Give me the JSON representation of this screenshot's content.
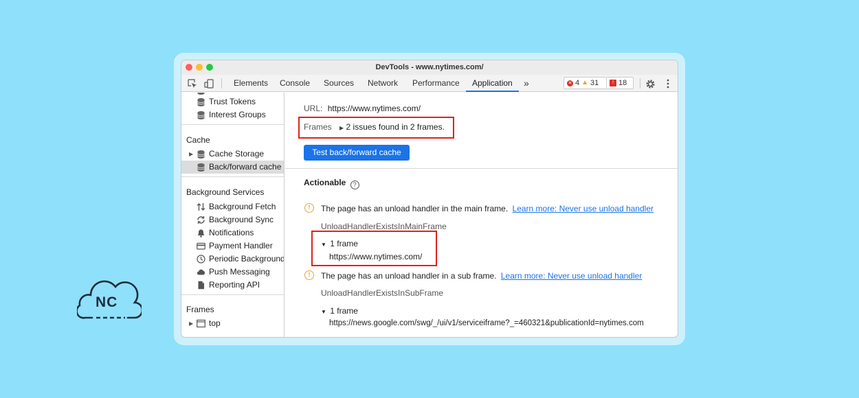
{
  "window": {
    "title": "DevTools - www.nytimes.com/"
  },
  "toolbar": {
    "icons": [
      "inspect-element-icon",
      "device-toolbar-icon",
      "more-tabs-icon",
      "settings-icon",
      "kebab-menu-icon"
    ],
    "tabs": [
      "Elements",
      "Console",
      "Sources",
      "Network",
      "Performance",
      "Application"
    ],
    "active_tab": "Application",
    "more_tabs": "»",
    "errors_count": "4",
    "warnings_count": "31",
    "issues_count": "18"
  },
  "sidebar": {
    "storage_items": [
      "Trust Tokens",
      "Interest Groups"
    ],
    "cache_header": "Cache",
    "cache_items": [
      "Cache Storage",
      "Back/forward cache"
    ],
    "selected_item": "Back/forward cache",
    "bg_header": "Background Services",
    "bg_items": [
      "Background Fetch",
      "Background Sync",
      "Notifications",
      "Payment Handler",
      "Periodic Background",
      "Push Messaging",
      "Reporting API"
    ],
    "frames_header": "Frames",
    "frames_items": [
      "top"
    ]
  },
  "main": {
    "url_label": "URL:",
    "url_value": "https://www.nytimes.com/",
    "frames_label": "Frames",
    "frames_summary": "2 issues found in 2 frames.",
    "test_button": "Test back/forward cache",
    "section_title": "Actionable",
    "issues": [
      {
        "text": "The page has an unload handler in the main frame.",
        "link": "Learn more: Never use unload handler",
        "reason": "UnloadHandlerExistsInMainFrame",
        "frame_count": "1 frame",
        "frame_url": "https://www.nytimes.com/"
      },
      {
        "text": "The page has an unload handler in a sub frame.",
        "link": "Learn more: Never use unload handler",
        "reason": "UnloadHandlerExistsInSubFrame",
        "frame_count": "1 frame",
        "frame_url": "https://news.google.com/swg/_/ui/v1/serviceiframe?_=460321&publicationId=nytimes.com"
      }
    ]
  },
  "logo": {
    "text": "NC"
  },
  "colors": {
    "background": "#8fe0fb",
    "accent": "#1a73e8",
    "highlight": "#e0201c",
    "warning": "#e8a33d"
  }
}
